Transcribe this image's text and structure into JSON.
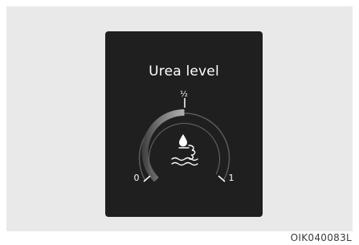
{
  "display": {
    "title": "Urea level",
    "tick_mid_label": "½",
    "tick_min_label": "0",
    "tick_max_label": "1",
    "level_fraction": 0.5,
    "icon": "urea-fluid-icon"
  },
  "figure": {
    "code": "OIK040083L"
  },
  "colors": {
    "frame": "#e9e9e9",
    "screen": "#1f1f1f",
    "text": "#ffffff",
    "gauge_fill": "#9a9a9a"
  }
}
